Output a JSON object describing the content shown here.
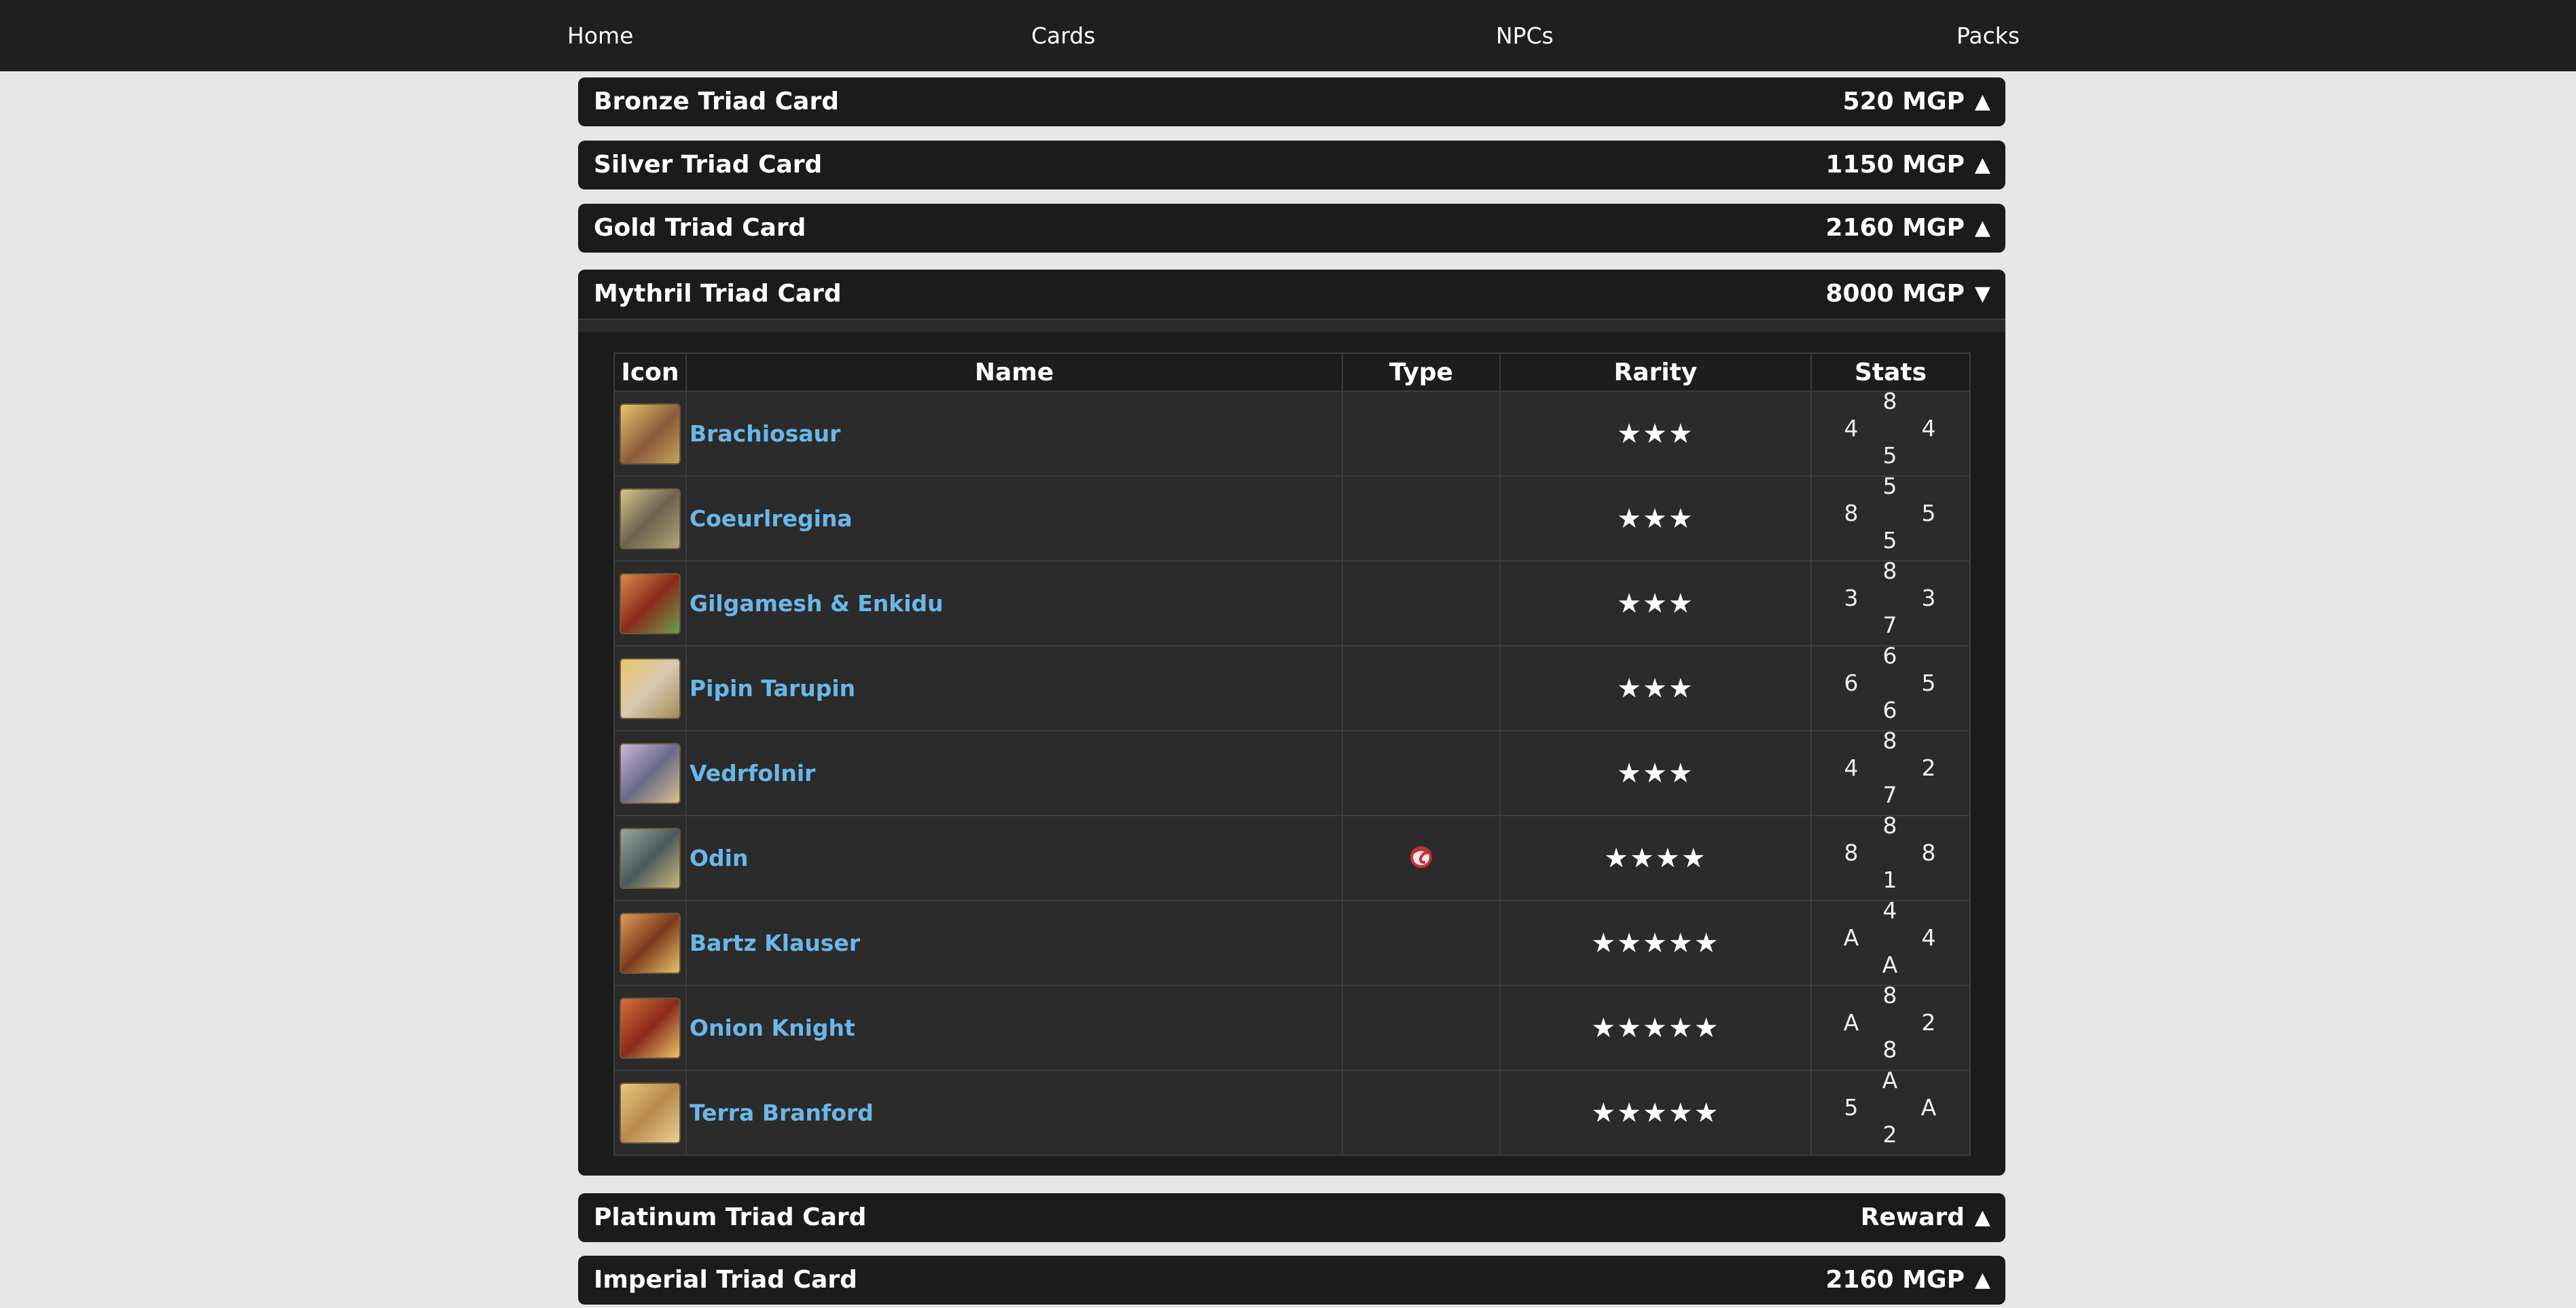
{
  "nav": {
    "home": "Home",
    "cards": "Cards",
    "npcs": "NPCs",
    "packs": "Packs"
  },
  "packs": [
    {
      "title": "Bronze Triad Card",
      "price": "520 MGP",
      "arrow": "▲"
    },
    {
      "title": "Silver Triad Card",
      "price": "1150 MGP",
      "arrow": "▲"
    },
    {
      "title": "Gold Triad Card",
      "price": "2160 MGP",
      "arrow": "▲"
    },
    {
      "title": "Mythril Triad Card",
      "price": "8000 MGP",
      "arrow": "▼"
    },
    {
      "title": "Platinum Triad Card",
      "price": "Reward",
      "arrow": "▲"
    },
    {
      "title": "Imperial Triad Card",
      "price": "2160 MGP",
      "arrow": "▲"
    }
  ],
  "table": {
    "headers": {
      "icon": "Icon",
      "name": "Name",
      "type": "Type",
      "rarity": "Rarity",
      "stats": "Stats"
    },
    "rows": [
      {
        "name": "Brachiosaur",
        "type": "",
        "rarity": "★★★",
        "stats": {
          "top": "8",
          "left": "4",
          "right": "4",
          "bottom": "5"
        }
      },
      {
        "name": "Coeurlregina",
        "type": "",
        "rarity": "★★★",
        "stats": {
          "top": "5",
          "left": "8",
          "right": "5",
          "bottom": "5"
        }
      },
      {
        "name": "Gilgamesh & Enkidu",
        "type": "",
        "rarity": "★★★",
        "stats": {
          "top": "8",
          "left": "3",
          "right": "3",
          "bottom": "7"
        }
      },
      {
        "name": "Pipin Tarupin",
        "type": "",
        "rarity": "★★★",
        "stats": {
          "top": "6",
          "left": "6",
          "right": "5",
          "bottom": "6"
        }
      },
      {
        "name": "Vedrfolnir",
        "type": "",
        "rarity": "★★★",
        "stats": {
          "top": "8",
          "left": "4",
          "right": "2",
          "bottom": "7"
        }
      },
      {
        "name": "Odin",
        "type": "primal-icon",
        "rarity": "★★★★",
        "stats": {
          "top": "8",
          "left": "8",
          "right": "8",
          "bottom": "1"
        }
      },
      {
        "name": "Bartz Klauser",
        "type": "",
        "rarity": "★★★★★",
        "stats": {
          "top": "4",
          "left": "A",
          "right": "4",
          "bottom": "A"
        }
      },
      {
        "name": "Onion Knight",
        "type": "",
        "rarity": "★★★★★",
        "stats": {
          "top": "8",
          "left": "A",
          "right": "2",
          "bottom": "8"
        }
      },
      {
        "name": "Terra Branford",
        "type": "",
        "rarity": "★★★★★",
        "stats": {
          "top": "A",
          "left": "5",
          "right": "A",
          "bottom": "2"
        }
      }
    ]
  },
  "colors": {
    "link": "#6ab7e8",
    "header_bg": "#1b1b1b",
    "page_bg": "#e6e6e6"
  }
}
